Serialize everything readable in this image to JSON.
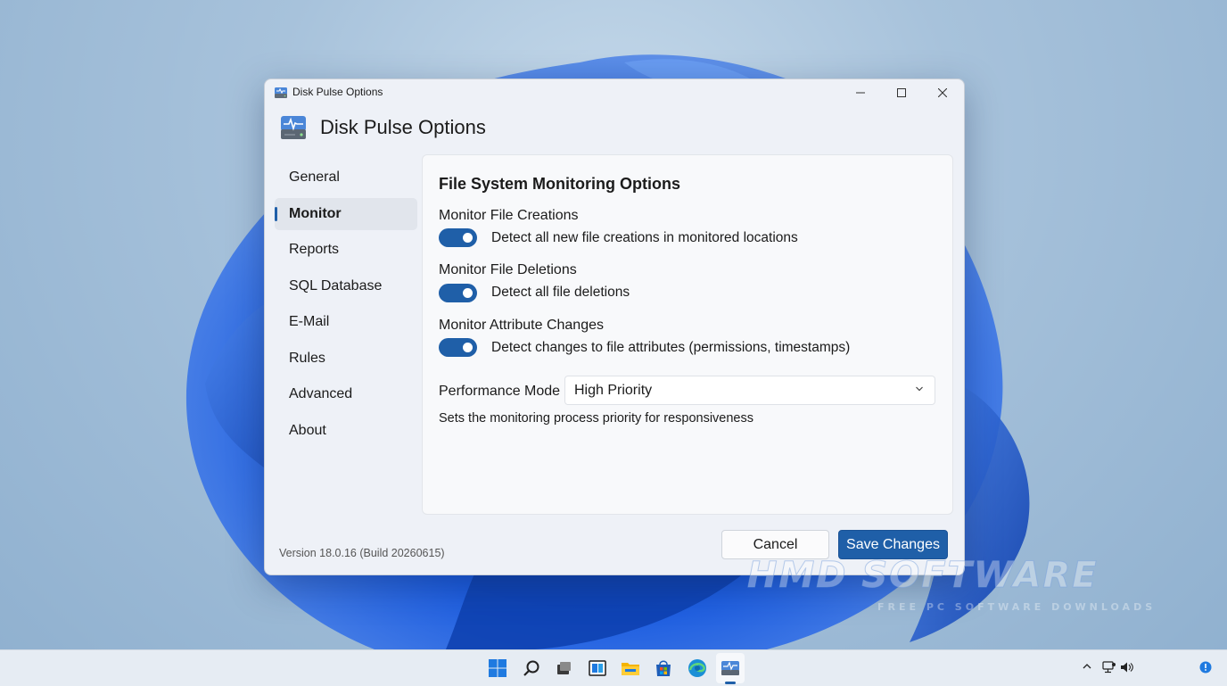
{
  "window": {
    "title": "Disk Pulse Options",
    "heading": "Disk Pulse Options",
    "controls": {
      "minimize": "minimize-icon",
      "maximize": "maximize-icon",
      "close": "close-icon"
    }
  },
  "sidebar": {
    "items": [
      {
        "label": "General",
        "active": false
      },
      {
        "label": "Monitor",
        "active": true
      },
      {
        "label": "Reports",
        "active": false
      },
      {
        "label": "SQL Database",
        "active": false
      },
      {
        "label": "E-Mail",
        "active": false
      },
      {
        "label": "Rules",
        "active": false
      },
      {
        "label": "Advanced",
        "active": false
      },
      {
        "label": "About",
        "active": false
      }
    ]
  },
  "content": {
    "section_title": "File System Monitoring Options",
    "options": [
      {
        "label": "Monitor File Creations",
        "toggle_on": true,
        "description": "Detect all new file creations in monitored locations"
      },
      {
        "label": "Monitor File Deletions",
        "toggle_on": true,
        "description": "Detect all file deletions"
      },
      {
        "label": "Monitor Attribute Changes",
        "toggle_on": true,
        "description": "Detect changes to file attributes (permissions, timestamps)"
      }
    ],
    "performance": {
      "label": "Performance Mode",
      "selected": "High Priority",
      "help": "Sets the monitoring process priority for responsiveness"
    }
  },
  "footer": {
    "version": "Version 18.0.16 (Build 20260615)",
    "cancel_label": "Cancel",
    "save_label": "Save Changes"
  },
  "watermark": {
    "main": "HMD SOFTWARE",
    "sub": "FREE PC SOFTWARE DOWNLOADS"
  },
  "taskbar": {
    "icons": [
      "windows-start-icon",
      "search-icon",
      "task-view-icon",
      "widgets-icon",
      "file-explorer-icon",
      "store-icon",
      "edge-browser-icon",
      "disk-pulse-icon"
    ],
    "tray_icons": [
      "chevron-up-icon",
      "network-icon",
      "volume-icon",
      "notification-icon"
    ]
  },
  "colors": {
    "accent": "#1f5fa8",
    "window_bg": "#eef1f7",
    "content_bg": "#f8f9fb"
  }
}
